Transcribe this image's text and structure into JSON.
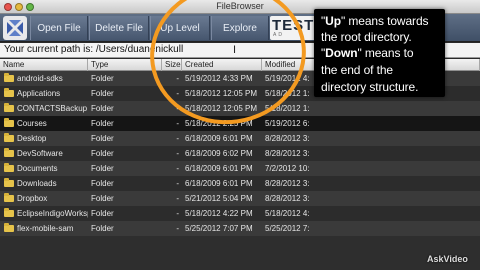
{
  "window": {
    "title": "FileBrowser"
  },
  "toolbar": {
    "open_file": "Open File",
    "delete_file": "Delete File",
    "up_level": "Up Level",
    "explore": "Explore",
    "brand_big": "TEST",
    "brand_small": "AD"
  },
  "path": {
    "text": "Your current path is: /Users/duanenickull"
  },
  "table": {
    "headers": [
      "Name",
      "Type",
      "Size",
      "Created",
      "Modified"
    ],
    "rows": [
      {
        "name": "android-sdks",
        "type": "Folder",
        "size": "-",
        "created": "5/19/2012 4:33 PM",
        "modified": "5/19/2012 4:"
      },
      {
        "name": "Applications",
        "type": "Folder",
        "size": "-",
        "created": "5/18/2012 12:05 PM",
        "modified": "5/18/2012 1:"
      },
      {
        "name": "CONTACTSBackup",
        "type": "Folder",
        "size": "-",
        "created": "5/18/2012 12:05 PM",
        "modified": "5/18/2012 1:"
      },
      {
        "name": "Courses",
        "type": "Folder",
        "size": "-",
        "created": "5/18/2012 2:25 PM",
        "modified": "5/19/2012 6:"
      },
      {
        "name": "Desktop",
        "type": "Folder",
        "size": "-",
        "created": "6/18/2009 6:01 PM",
        "modified": "8/28/2012 3:"
      },
      {
        "name": "DevSoftware",
        "type": "Folder",
        "size": "-",
        "created": "6/18/2009 6:02 PM",
        "modified": "8/28/2012 3:"
      },
      {
        "name": "Documents",
        "type": "Folder",
        "size": "-",
        "created": "6/18/2009 6:01 PM",
        "modified": "7/2/2012 10:"
      },
      {
        "name": "Downloads",
        "type": "Folder",
        "size": "-",
        "created": "6/18/2009 6:01 PM",
        "modified": "8/28/2012 3:"
      },
      {
        "name": "Dropbox",
        "type": "Folder",
        "size": "-",
        "created": "5/21/2012 5:04 PM",
        "modified": "8/28/2012 3:"
      },
      {
        "name": "EclipseIndigoWorkspace",
        "type": "Folder",
        "size": "-",
        "created": "5/18/2012 4:22 PM",
        "modified": "5/18/2012 4:"
      },
      {
        "name": "flex-mobile-sam",
        "type": "Folder",
        "size": "-",
        "created": "5/25/2012 7:07 PM",
        "modified": "5/25/2012 7:"
      }
    ]
  },
  "annotation": {
    "up_word": "Up",
    "line1_rest": "\" means towards",
    "line2": "the root directory.",
    "down_word": "Down",
    "line3_rest": "\" means to",
    "line4": "the end of the",
    "line5": "directory structure."
  },
  "watermark": "AskVideo",
  "colors": {
    "highlight_circle": "#f39a21",
    "folder_icon": "#e6c34a",
    "toolbar": "#4f5f78"
  }
}
